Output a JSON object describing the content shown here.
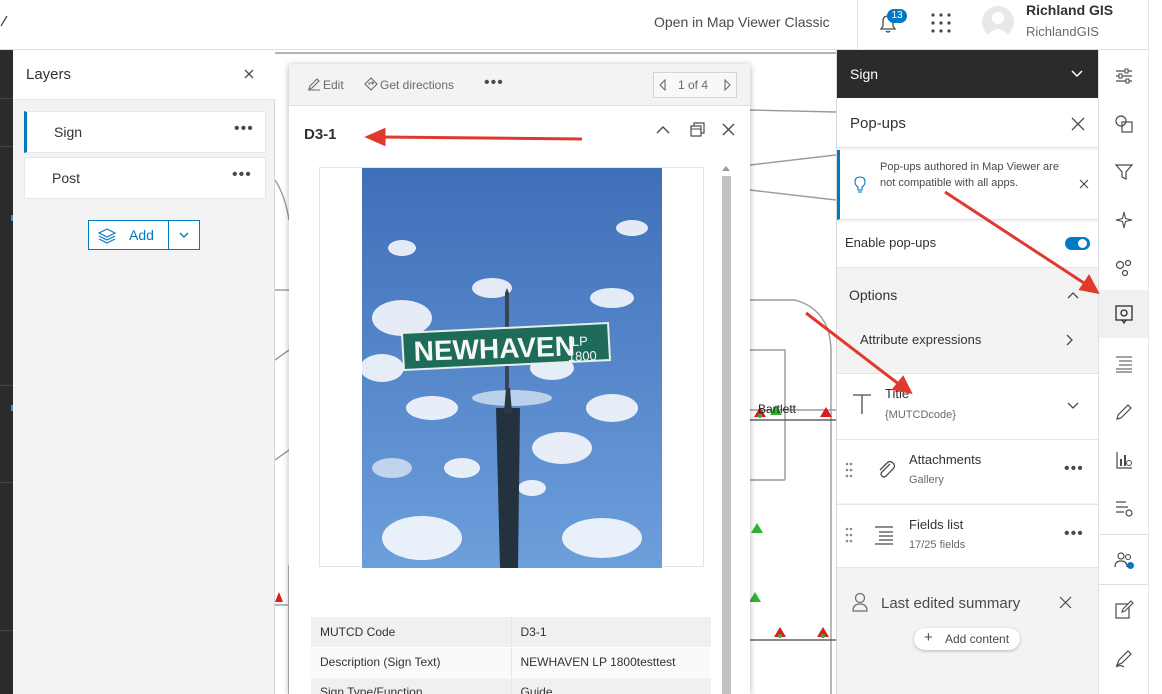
{
  "header": {
    "open_classic": "Open in Map Viewer Classic",
    "notification_count": "13",
    "user_name": "Richland GIS",
    "user_id": "RichlandGIS"
  },
  "layers_panel": {
    "title": "Layers",
    "items": [
      {
        "label": "Sign",
        "selected": true
      },
      {
        "label": "Post",
        "selected": false
      }
    ],
    "add_label": "Add"
  },
  "map": {
    "labels": [
      "Bartlett"
    ]
  },
  "popup": {
    "toolbar": {
      "edit_label": "Edit",
      "directions_label": "Get directions",
      "pager": "1 of 4"
    },
    "title": "D3-1",
    "sign_text_line1": "NEWHAVEN",
    "sign_text_line2a": "LP",
    "sign_text_line2b": "1800",
    "fields": [
      {
        "key": "MUTCD Code",
        "value": "D3-1"
      },
      {
        "key": "Description (Sign Text)",
        "value": "NEWHAVEN LP 1800testtest"
      },
      {
        "key": "Sign Type/Function",
        "value": "Guide"
      }
    ]
  },
  "sign_panel": {
    "layer_name": "Sign",
    "panel_title": "Pop-ups",
    "notice_text": "Pop-ups authored in Map Viewer are not compatible with all apps.",
    "enable_label": "Enable pop-ups",
    "options_label": "Options",
    "attr_expr_label": "Attribute expressions",
    "blocks": [
      {
        "title": "Title",
        "sub": "{MUTCDcode}"
      },
      {
        "title": "Attachments",
        "sub": "Gallery"
      },
      {
        "title": "Fields list",
        "sub": "17/25 fields"
      }
    ],
    "last_edited_label": "Last edited summary",
    "add_content_label": "Add content"
  },
  "colors": {
    "accent": "#007ac2",
    "arrow": "#e0392e",
    "dark_header": "#2b2b2b"
  }
}
